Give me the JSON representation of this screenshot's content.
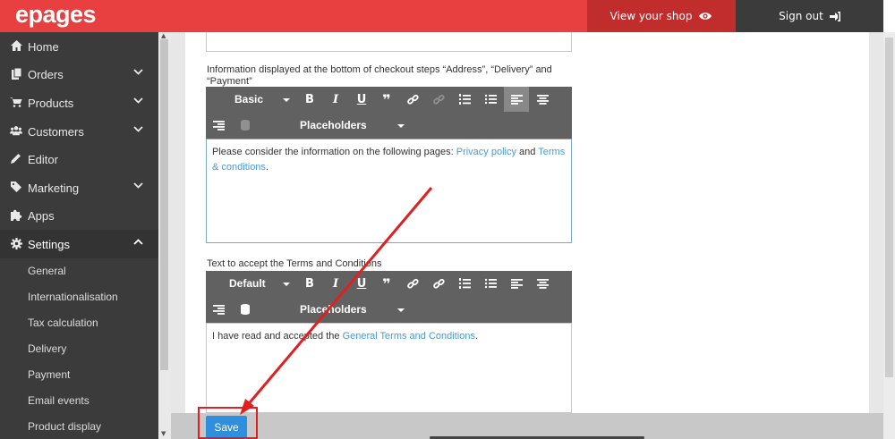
{
  "header": {
    "logo": "epages",
    "view_shop": "View your shop",
    "sign_out": "Sign out",
    "brand_color": "#e84040"
  },
  "sidebar": {
    "items": [
      {
        "label": "Home",
        "icon": "home-icon",
        "has_chevron": false
      },
      {
        "label": "Orders",
        "icon": "orders-icon",
        "has_chevron": true
      },
      {
        "label": "Products",
        "icon": "cart-icon",
        "has_chevron": true
      },
      {
        "label": "Customers",
        "icon": "users-icon",
        "has_chevron": true
      },
      {
        "label": "Editor",
        "icon": "pencil-icon",
        "has_chevron": false
      },
      {
        "label": "Marketing",
        "icon": "tag-icon",
        "has_chevron": true
      },
      {
        "label": "Apps",
        "icon": "puzzle-icon",
        "has_chevron": false
      },
      {
        "label": "Settings",
        "icon": "gear-icon",
        "has_chevron": true,
        "expanded": true
      }
    ],
    "sub_items": [
      "General",
      "Internationalisation",
      "Tax calculation",
      "Delivery",
      "Payment",
      "Email events",
      "Product display"
    ]
  },
  "form": {
    "field1": {
      "label": "Information displayed at the bottom of checkout steps “Address”, “Delivery” and “Payment”",
      "format": "Basic",
      "placeholders": "Placeholders",
      "text_before": "Please consider the information on the following pages: ",
      "link1": "Privacy policy",
      "text_mid": " and ",
      "link2": "Terms & conditions",
      "text_after": "."
    },
    "field2": {
      "label": "Text to accept the Terms and Conditions",
      "format": "Default",
      "placeholders": "Placeholders",
      "text_before": "I have read and accepted the ",
      "link1": "General Terms and Conditions",
      "text_after": "."
    }
  },
  "footer": {
    "save": "Save",
    "save_color": "#2f8fdc"
  },
  "annotation": {
    "highlight_color": "#e02020"
  }
}
